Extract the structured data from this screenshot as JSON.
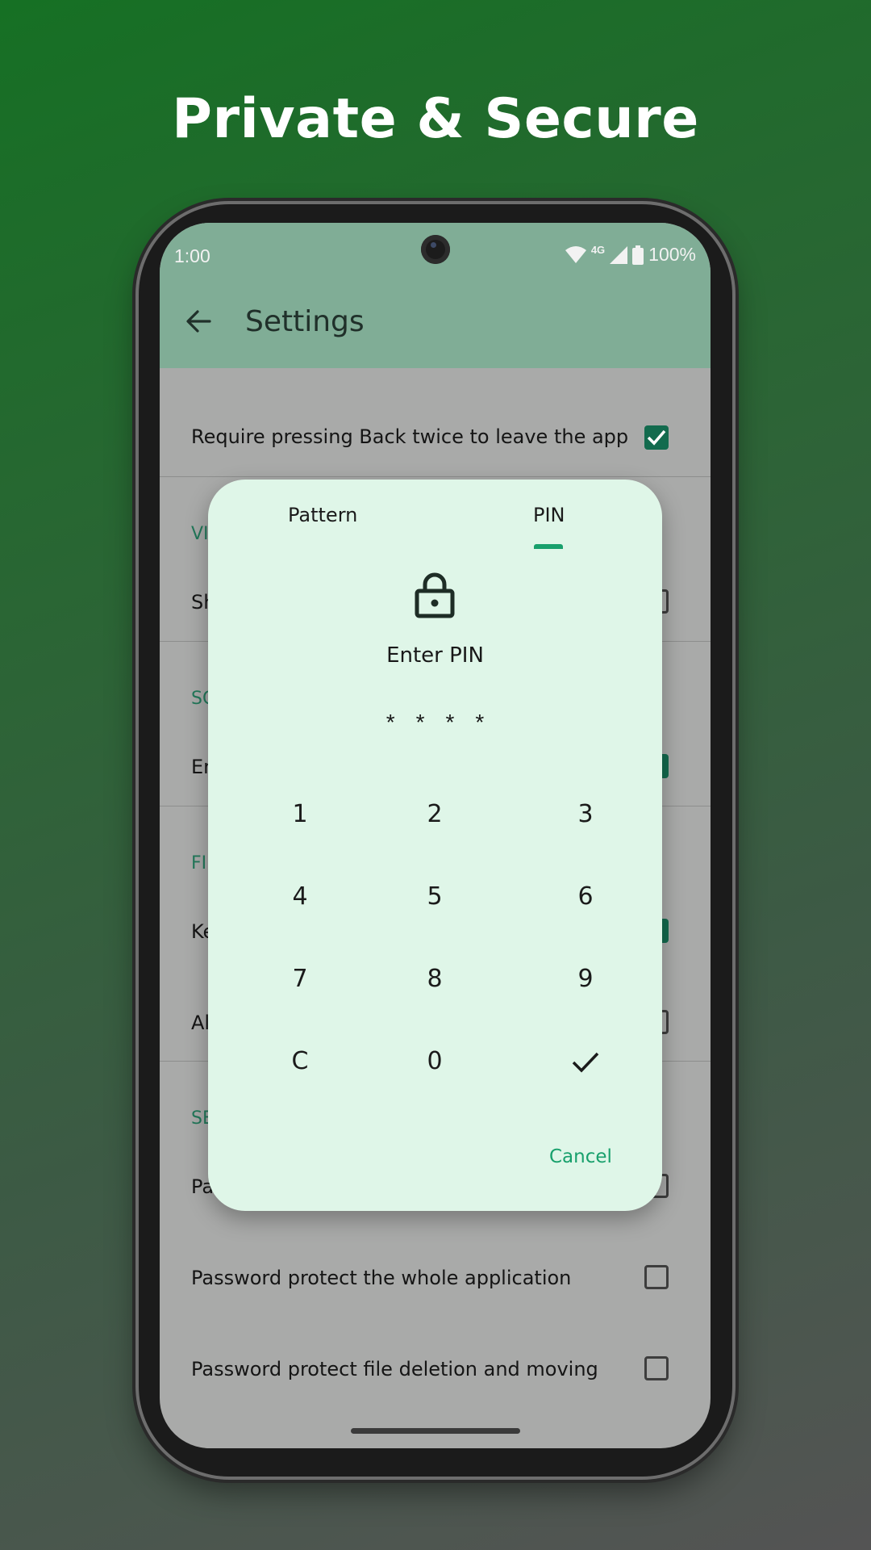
{
  "headline": "Private & Secure",
  "status_bar": {
    "time": "1:00",
    "network": "4G",
    "battery": "100%"
  },
  "app_bar": {
    "title": "Settings",
    "back_icon": "arrow-back-icon"
  },
  "settings": {
    "top_row": {
      "label": "Require pressing Back twice to leave the app",
      "checked": true
    },
    "partial_rows": [
      {
        "section": "VI",
        "label": "Sh",
        "checked": false
      },
      {
        "section": "SC",
        "label": "En",
        "checked": true
      },
      {
        "section": "FI",
        "label": "Ke",
        "checked": true
      },
      {
        "section": "",
        "label": "Al",
        "checked": false
      },
      {
        "section": "SE",
        "label": "Pa",
        "checked": false
      }
    ],
    "bottom_rows": [
      {
        "label": "Password protect the whole application",
        "checked": false
      },
      {
        "label": "Password protect file deletion and moving",
        "checked": false
      }
    ]
  },
  "dialog": {
    "tabs": {
      "pattern": "Pattern",
      "pin": "PIN",
      "selected": "PIN"
    },
    "lock_icon": "lock-icon",
    "prompt": "Enter PIN",
    "pin_mask": "****",
    "keys": {
      "k1": "1",
      "k2": "2",
      "k3": "3",
      "k4": "4",
      "k5": "5",
      "k6": "6",
      "k7": "7",
      "k8": "8",
      "k9": "9",
      "clear": "C",
      "k0": "0",
      "confirm_icon": "check-icon"
    },
    "cancel": "Cancel"
  },
  "colors": {
    "accent": "#18a06c",
    "app_bar": "#80ad96",
    "dialog_bg": "#dff6e8",
    "checkbox_on": "#136b4e"
  }
}
